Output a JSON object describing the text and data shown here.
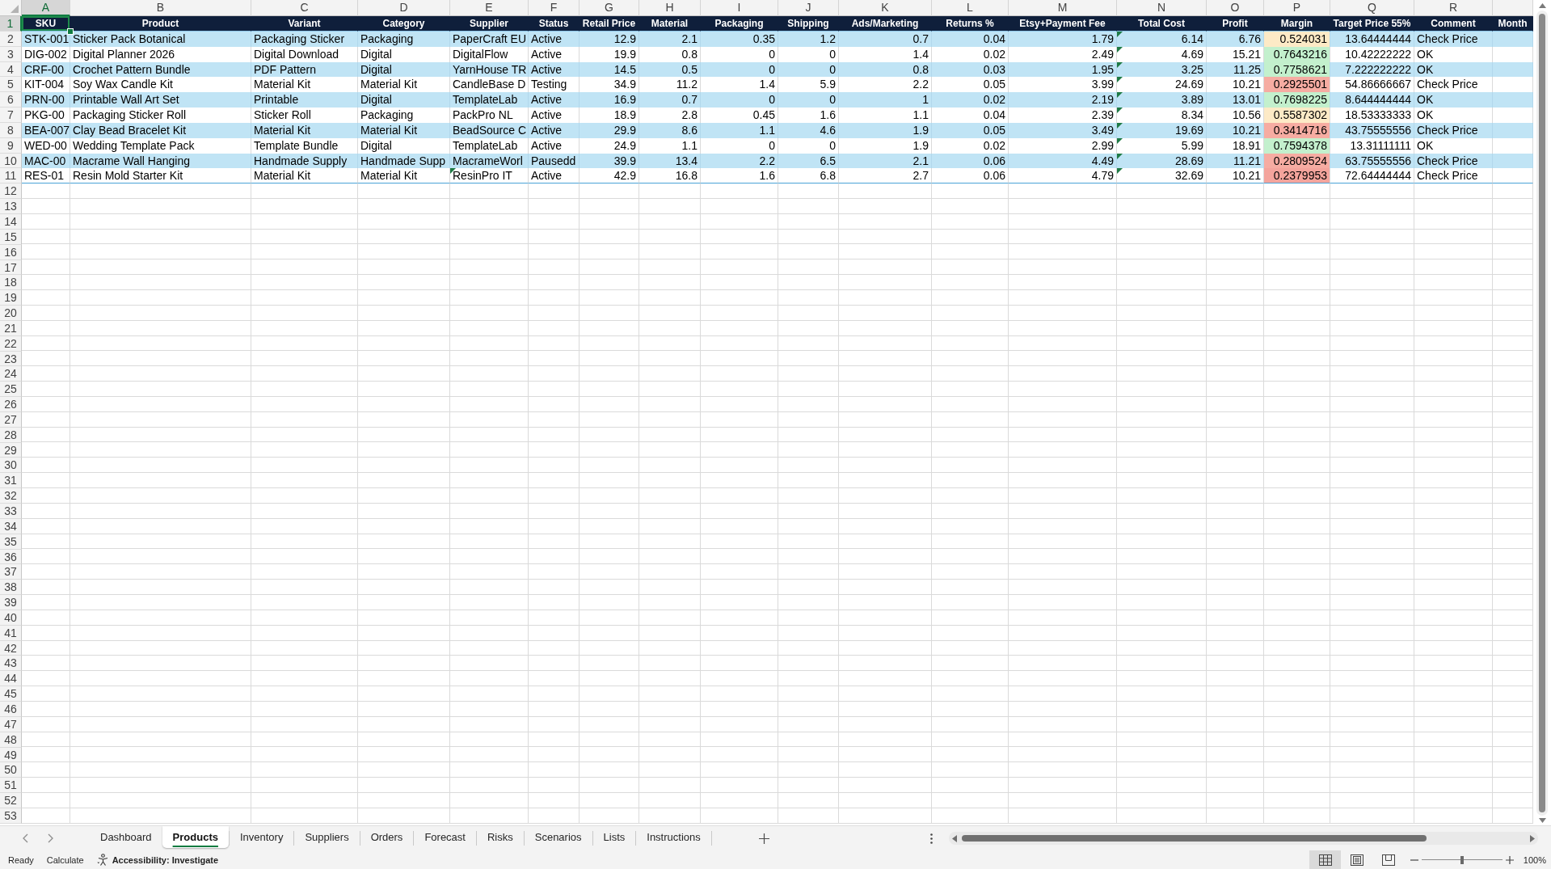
{
  "column_letters": [
    {
      "label": "A",
      "selected": true
    },
    {
      "label": "B",
      "selected": false
    },
    {
      "label": "C",
      "selected": false
    },
    {
      "label": "D",
      "selected": false
    },
    {
      "label": "E",
      "selected": false
    },
    {
      "label": "F",
      "selected": false
    },
    {
      "label": "G",
      "selected": false
    },
    {
      "label": "H",
      "selected": false
    },
    {
      "label": "I",
      "selected": false
    },
    {
      "label": "J",
      "selected": false
    },
    {
      "label": "K",
      "selected": false
    },
    {
      "label": "L",
      "selected": false
    },
    {
      "label": "M",
      "selected": false
    },
    {
      "label": "N",
      "selected": false
    },
    {
      "label": "O",
      "selected": false
    },
    {
      "label": "P",
      "selected": false
    },
    {
      "label": "Q",
      "selected": false
    },
    {
      "label": "R",
      "selected": false
    }
  ],
  "row_numbers": [
    {
      "label": "1",
      "selected": true
    },
    {
      "label": "2",
      "selected": false
    },
    {
      "label": "3",
      "selected": false
    },
    {
      "label": "4",
      "selected": false
    },
    {
      "label": "5",
      "selected": false
    },
    {
      "label": "6",
      "selected": false
    },
    {
      "label": "7",
      "selected": false
    },
    {
      "label": "8",
      "selected": false
    },
    {
      "label": "9",
      "selected": false
    },
    {
      "label": "10",
      "selected": false
    },
    {
      "label": "11",
      "selected": false
    },
    {
      "label": "12",
      "selected": false
    },
    {
      "label": "13",
      "selected": false
    },
    {
      "label": "14",
      "selected": false
    },
    {
      "label": "15",
      "selected": false
    },
    {
      "label": "16",
      "selected": false
    },
    {
      "label": "17",
      "selected": false
    },
    {
      "label": "18",
      "selected": false
    },
    {
      "label": "19",
      "selected": false
    },
    {
      "label": "20",
      "selected": false
    },
    {
      "label": "21",
      "selected": false
    },
    {
      "label": "22",
      "selected": false
    },
    {
      "label": "23",
      "selected": false
    },
    {
      "label": "24",
      "selected": false
    },
    {
      "label": "25",
      "selected": false
    },
    {
      "label": "26",
      "selected": false
    },
    {
      "label": "27",
      "selected": false
    },
    {
      "label": "28",
      "selected": false
    },
    {
      "label": "29",
      "selected": false
    },
    {
      "label": "30",
      "selected": false
    },
    {
      "label": "31",
      "selected": false
    },
    {
      "label": "32",
      "selected": false
    },
    {
      "label": "33",
      "selected": false
    },
    {
      "label": "34",
      "selected": false
    },
    {
      "label": "35",
      "selected": false
    },
    {
      "label": "36",
      "selected": false
    },
    {
      "label": "37",
      "selected": false
    },
    {
      "label": "38",
      "selected": false
    },
    {
      "label": "39",
      "selected": false
    },
    {
      "label": "40",
      "selected": false
    },
    {
      "label": "41",
      "selected": false
    },
    {
      "label": "42",
      "selected": false
    },
    {
      "label": "43",
      "selected": false
    },
    {
      "label": "44",
      "selected": false
    },
    {
      "label": "45",
      "selected": false
    },
    {
      "label": "46",
      "selected": false
    },
    {
      "label": "47",
      "selected": false
    },
    {
      "label": "48",
      "selected": false
    },
    {
      "label": "49",
      "selected": false
    },
    {
      "label": "50",
      "selected": false
    },
    {
      "label": "51",
      "selected": false
    },
    {
      "label": "52",
      "selected": false
    },
    {
      "label": "53",
      "selected": false
    }
  ],
  "header_row": [
    "SKU",
    "Product",
    "Variant",
    "Category",
    "Supplier",
    "Status",
    "Retail Price",
    "Material",
    "Packaging",
    "Shipping",
    "Ads/Marketing",
    "Returns %",
    "Etsy+Payment Fee",
    "Total Cost",
    "Profit",
    "Margin",
    "Target Price 55%",
    "Comment",
    "Month"
  ],
  "rows": [
    {
      "sku": "STK-001",
      "product": "Sticker Pack Botanical",
      "variant": "Packaging Sticker",
      "category": "Packaging",
      "supplier": "PaperCraft EU",
      "supplier_flagged": false,
      "status": "Active",
      "retail_price": "12.9",
      "material": "2.1",
      "packaging": "0.35",
      "shipping": "1.2",
      "ads_marketing": "0.7",
      "returns_pct": "0.04",
      "fee": "1.79",
      "total_cost": "6.14",
      "total_cost_flagged": true,
      "profit": "6.76",
      "margin": {
        "value": "0.524031",
        "color": "#fdeac6"
      },
      "target_price": "13.64444444",
      "comment": "Check Price"
    },
    {
      "sku": "DIG-002",
      "product": "Digital Planner 2026",
      "variant": "Digital Download",
      "category": "Digital",
      "supplier": "DigitalFlow",
      "supplier_flagged": false,
      "status": "Active",
      "retail_price": "19.9",
      "material": "0.8",
      "packaging": "0",
      "shipping": "0",
      "ads_marketing": "1.4",
      "returns_pct": "0.02",
      "fee": "2.49",
      "total_cost": "4.69",
      "total_cost_flagged": true,
      "profit": "15.21",
      "margin": {
        "value": "0.7643216",
        "color": "#c3f0cd"
      },
      "target_price": "10.42222222",
      "comment": "OK"
    },
    {
      "sku": "CRF-00",
      "product": "Crochet Pattern Bundle",
      "variant": "PDF Pattern",
      "category": "Digital",
      "supplier": "YarnHouse TR",
      "supplier_flagged": false,
      "status": "Active",
      "retail_price": "14.5",
      "material": "0.5",
      "packaging": "0",
      "shipping": "0",
      "ads_marketing": "0.8",
      "returns_pct": "0.03",
      "fee": "1.95",
      "total_cost": "3.25",
      "total_cost_flagged": true,
      "profit": "11.25",
      "margin": {
        "value": "0.7758621",
        "color": "#c3f0cd"
      },
      "target_price": "7.222222222",
      "comment": "OK"
    },
    {
      "sku": "KIT-004",
      "product": "Soy Wax Candle Kit",
      "variant": "Material Kit",
      "category": "Material Kit",
      "supplier": "CandleBase D",
      "supplier_flagged": false,
      "status": "Testing",
      "retail_price": "34.9",
      "material": "11.2",
      "packaging": "1.4",
      "shipping": "5.9",
      "ads_marketing": "2.2",
      "returns_pct": "0.05",
      "fee": "3.99",
      "total_cost": "24.69",
      "total_cost_flagged": true,
      "profit": "10.21",
      "margin": {
        "value": "0.2925501",
        "color": "#f6aca2"
      },
      "target_price": "54.86666667",
      "comment": "Check Price"
    },
    {
      "sku": "PRN-00",
      "product": "Printable Wall Art Set",
      "variant": "Printable",
      "category": "Digital",
      "supplier": "TemplateLab",
      "supplier_flagged": false,
      "status": "Active",
      "retail_price": "16.9",
      "material": "0.7",
      "packaging": "0",
      "shipping": "0",
      "ads_marketing": "1",
      "returns_pct": "0.02",
      "fee": "2.19",
      "total_cost": "3.89",
      "total_cost_flagged": true,
      "profit": "13.01",
      "margin": {
        "value": "0.7698225",
        "color": "#c3f0cd"
      },
      "target_price": "8.644444444",
      "comment": "OK"
    },
    {
      "sku": "PKG-00",
      "product": "Packaging Sticker Roll",
      "variant": "Sticker Roll",
      "category": "Packaging",
      "supplier": "PackPro NL",
      "supplier_flagged": false,
      "status": "Active",
      "retail_price": "18.9",
      "material": "2.8",
      "packaging": "0.45",
      "shipping": "1.6",
      "ads_marketing": "1.1",
      "returns_pct": "0.04",
      "fee": "2.39",
      "total_cost": "8.34",
      "total_cost_flagged": true,
      "profit": "10.56",
      "margin": {
        "value": "0.5587302",
        "color": "#fdeac6"
      },
      "target_price": "18.53333333",
      "comment": "OK"
    },
    {
      "sku": "BEA-007",
      "product": "Clay Bead Bracelet Kit",
      "variant": "Material Kit",
      "category": "Material Kit",
      "supplier": "BeadSource C",
      "supplier_flagged": false,
      "status": "Active",
      "retail_price": "29.9",
      "material": "8.6",
      "packaging": "1.1",
      "shipping": "4.6",
      "ads_marketing": "1.9",
      "returns_pct": "0.05",
      "fee": "3.49",
      "total_cost": "19.69",
      "total_cost_flagged": true,
      "profit": "10.21",
      "margin": {
        "value": "0.3414716",
        "color": "#f6aca2"
      },
      "target_price": "43.75555556",
      "comment": "Check Price"
    },
    {
      "sku": "WED-00",
      "product": "Wedding Template Pack",
      "variant": "Template Bundle",
      "category": "Digital",
      "supplier": "TemplateLab",
      "supplier_flagged": false,
      "status": "Active",
      "retail_price": "24.9",
      "material": "1.1",
      "packaging": "0",
      "shipping": "0",
      "ads_marketing": "1.9",
      "returns_pct": "0.02",
      "fee": "2.99",
      "total_cost": "5.99",
      "total_cost_flagged": true,
      "profit": "18.91",
      "margin": {
        "value": "0.7594378",
        "color": "#c3f0cd"
      },
      "target_price": "13.31111111",
      "comment": "OK"
    },
    {
      "sku": "MAC-00",
      "product": "Macrame Wall Hanging",
      "variant": "Handmade Supply",
      "category": "Handmade Supp",
      "supplier": "MacrameWorl",
      "supplier_flagged": false,
      "status": "Pausedd",
      "retail_price": "39.9",
      "material": "13.4",
      "packaging": "2.2",
      "shipping": "6.5",
      "ads_marketing": "2.1",
      "returns_pct": "0.06",
      "fee": "4.49",
      "total_cost": "28.69",
      "total_cost_flagged": true,
      "profit": "11.21",
      "margin": {
        "value": "0.2809524",
        "color": "#f6aca2"
      },
      "target_price": "63.75555556",
      "comment": "Check Price"
    },
    {
      "sku": "RES-01",
      "product": "Resin Mold Starter Kit",
      "variant": "Material Kit",
      "category": "Material Kit",
      "supplier": "ResinPro IT",
      "supplier_flagged": true,
      "status": "Active",
      "retail_price": "42.9",
      "material": "16.8",
      "packaging": "1.6",
      "shipping": "6.8",
      "ads_marketing": "2.7",
      "returns_pct": "0.06",
      "fee": "4.79",
      "total_cost": "32.69",
      "total_cost_flagged": true,
      "profit": "10.21",
      "margin": {
        "value": "0.2379953",
        "color": "#f4a49c"
      },
      "target_price": "72.64444444",
      "comment": "Check Price"
    }
  ],
  "sheet_tabs": [
    {
      "label": "Dashboard",
      "selected": false
    },
    {
      "label": "Products",
      "selected": true
    },
    {
      "label": "Inventory",
      "selected": false
    },
    {
      "label": "Suppliers",
      "selected": false
    },
    {
      "label": "Orders",
      "selected": false
    },
    {
      "label": "Forecast",
      "selected": false
    },
    {
      "label": "Risks",
      "selected": false
    },
    {
      "label": "Scenarios",
      "selected": false
    },
    {
      "label": "Lists",
      "selected": false
    },
    {
      "label": "Instructions",
      "selected": false
    }
  ],
  "status_bar": {
    "mode": "Ready",
    "calculate": "Calculate",
    "accessibility": "Accessibility: Investigate",
    "views": [
      {
        "kind": "normal",
        "selected": true
      },
      {
        "kind": "page_layout",
        "selected": false
      },
      {
        "kind": "page_break",
        "selected": false
      }
    ],
    "zoom_slider": {
      "level": 0.5
    },
    "zoom": "100%"
  }
}
